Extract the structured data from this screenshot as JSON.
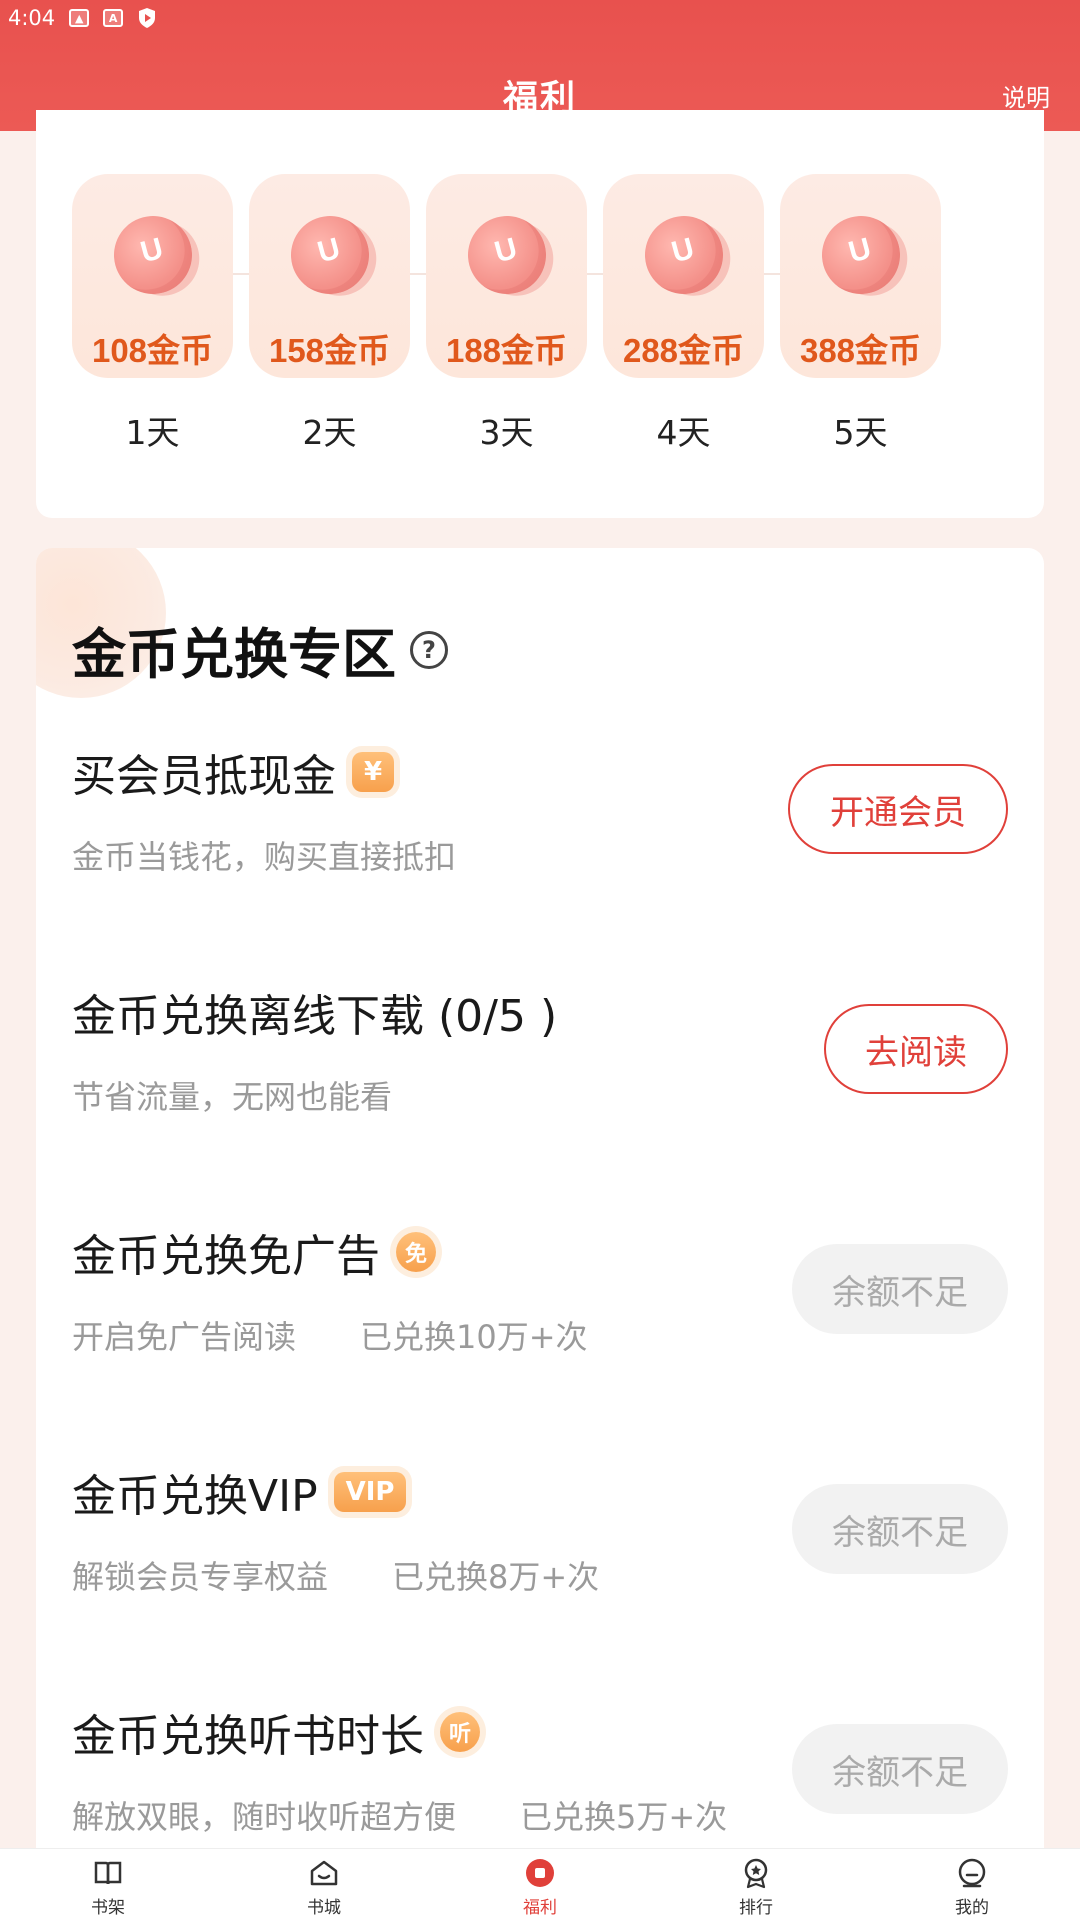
{
  "status_bar": {
    "time": "4:04"
  },
  "header": {
    "title": "福利",
    "help_label": "说明"
  },
  "checkin": {
    "days": [
      {
        "amount": "108金币",
        "label": "1天"
      },
      {
        "amount": "158金币",
        "label": "2天"
      },
      {
        "amount": "188金币",
        "label": "3天"
      },
      {
        "amount": "288金币",
        "label": "4天"
      },
      {
        "amount": "388金币",
        "label": "5天"
      }
    ]
  },
  "exchange": {
    "title": "金币兑换专区",
    "help_icon": "?",
    "items": [
      {
        "name": "买会员抵现金",
        "badge": "¥",
        "desc": "金币当钱花，购买直接抵扣",
        "button": "开通会员"
      },
      {
        "name": "金币兑换离线下载 (0/5 )",
        "desc": "节省流量，无网也能看",
        "button": "去阅读"
      },
      {
        "name": "金币兑换免广告",
        "badge": "免",
        "desc": "开启免广告阅读　　已兑换10万+次",
        "button": "余额不足"
      },
      {
        "name": "金币兑换VIP",
        "badge": "VIP",
        "desc": "解锁会员专享权益　　已兑换8万+次",
        "button": "余额不足"
      },
      {
        "name": "金币兑换听书时长",
        "badge": "听",
        "desc": "解放双眼，随时收听超方便　　已兑换5万+次",
        "button": "余额不足"
      }
    ]
  },
  "bottom_nav": {
    "items": [
      {
        "label": "书架",
        "icon": "bookshelf-icon"
      },
      {
        "label": "书城",
        "icon": "bookstore-icon"
      },
      {
        "label": "福利",
        "icon": "welfare-icon",
        "active": true
      },
      {
        "label": "排行",
        "icon": "ranking-icon"
      },
      {
        "label": "我的",
        "icon": "profile-icon"
      }
    ]
  },
  "colors": {
    "accent": "#e0403a",
    "header": "#e8514e",
    "coin_text": "#e0581c"
  }
}
